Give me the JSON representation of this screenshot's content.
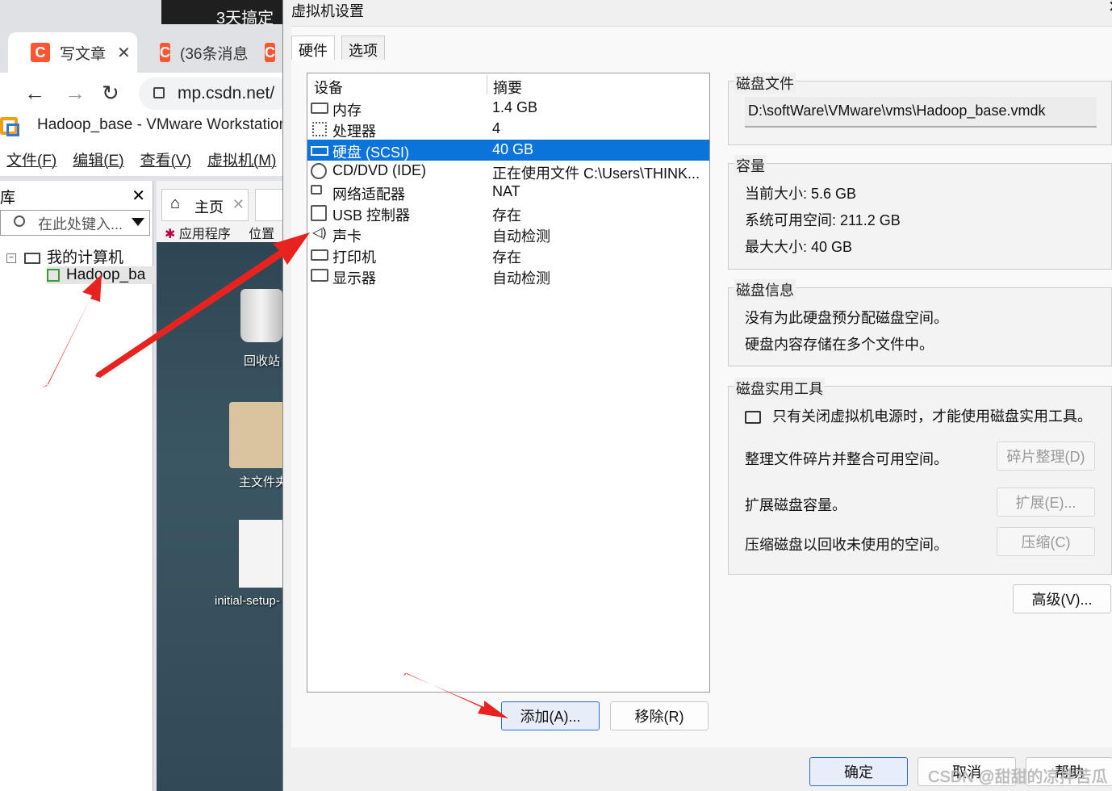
{
  "browser": {
    "top_strip_text": "3天搞定",
    "tabs": [
      "写文章",
      "(36条消息"
    ],
    "url": "mp.csdn.net/",
    "vmware_title": "Hadoop_base - VMware Workstation",
    "vmware_menu": [
      "文件(F)",
      "编辑(E)",
      "查看(V)",
      "虚拟机(M)"
    ],
    "library_title": "库",
    "library_search_placeholder": "在此处键入...",
    "tree_root": "我的计算机",
    "tree_vm": "Hadoop_ba",
    "home_tab": "主页",
    "guest_menu": [
      "应用程序",
      "位置"
    ],
    "desktop_icons": [
      "回收站",
      "主文件夹",
      "initial-setup-"
    ]
  },
  "dialog": {
    "title": "虚拟机设置",
    "tabs": [
      "硬件",
      "选项"
    ],
    "device_list": {
      "headers": [
        "设备",
        "摘要"
      ],
      "rows": [
        {
          "name": "内存",
          "summary": "1.4 GB",
          "icon": "memory-icon"
        },
        {
          "name": "处理器",
          "summary": "4",
          "icon": "processor-icon"
        },
        {
          "name": "硬盘 (SCSI)",
          "summary": "40 GB",
          "icon": "harddisk-icon",
          "selected": true
        },
        {
          "name": "CD/DVD (IDE)",
          "summary": "正在使用文件 C:\\Users\\THINK...",
          "icon": "cd-icon"
        },
        {
          "name": "网络适配器",
          "summary": "NAT",
          "icon": "network-icon"
        },
        {
          "name": "USB 控制器",
          "summary": "存在",
          "icon": "usb-icon"
        },
        {
          "name": "声卡",
          "summary": "自动检测",
          "icon": "sound-icon"
        },
        {
          "name": "打印机",
          "summary": "存在",
          "icon": "printer-icon"
        },
        {
          "name": "显示器",
          "summary": "自动检测",
          "icon": "display-icon"
        }
      ]
    },
    "add_button": "添加(A)...",
    "remove_button": "移除(R)",
    "disk_file": {
      "label": "磁盘文件",
      "path": "D:\\softWare\\VMware\\vms\\Hadoop_base.vmdk"
    },
    "capacity": {
      "label": "容量",
      "current": "当前大小: 5.6 GB",
      "available": "系统可用空间: 211.2 GB",
      "max": "最大大小: 40 GB"
    },
    "disk_info": {
      "label": "磁盘信息",
      "line1": "没有为此硬盘预分配磁盘空间。",
      "line2": "硬盘内容存储在多个文件中。"
    },
    "utilities": {
      "label": "磁盘实用工具",
      "notice": "只有关闭虚拟机电源时，才能使用磁盘实用工具。",
      "defrag_text": "整理文件碎片并整合可用空间。",
      "defrag_button": "碎片整理(D)",
      "expand_text": "扩展磁盘容量。",
      "expand_button": "扩展(E)...",
      "compact_text": "压缩磁盘以回收未使用的空间。",
      "compact_button": "压缩(C)"
    },
    "advanced_button": "高级(V)...",
    "ok_button": "确定",
    "cancel_button": "取消",
    "help_button": "帮助"
  },
  "watermark": "CSDN @甜甜的凉拌苦瓜",
  "colors": {
    "selection": "#0a74da",
    "annotation_arrow": "#e8231f",
    "csdn_brand": "#fc5531"
  }
}
